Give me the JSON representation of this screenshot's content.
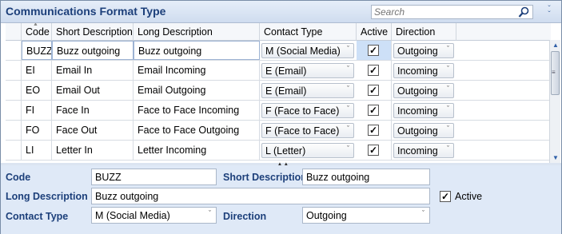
{
  "window": {
    "title": "Communications Format Type"
  },
  "search": {
    "placeholder": "Search"
  },
  "grid": {
    "columns": [
      "Code",
      "Short Description",
      "Long Description",
      "Contact Type",
      "Active",
      "Direction"
    ],
    "rows": [
      {
        "code": "BUZZ",
        "short": "Buzz outgoing",
        "long": "Buzz outgoing",
        "contact": "M (Social Media)",
        "active": true,
        "direction": "Outgoing"
      },
      {
        "code": "EI",
        "short": "Email In",
        "long": "Email Incoming",
        "contact": "E (Email)",
        "active": true,
        "direction": "Incoming"
      },
      {
        "code": "EO",
        "short": "Email Out",
        "long": "Email Outgoing",
        "contact": "E (Email)",
        "active": true,
        "direction": "Outgoing"
      },
      {
        "code": "FI",
        "short": "Face In",
        "long": "Face to Face Incoming",
        "contact": "F (Face to Face)",
        "active": true,
        "direction": "Incoming"
      },
      {
        "code": "FO",
        "short": "Face Out",
        "long": "Face to Face Outgoing",
        "contact": "F (Face to Face)",
        "active": true,
        "direction": "Outgoing"
      },
      {
        "code": "LI",
        "short": "Letter In",
        "long": "Letter Incoming",
        "contact": "L (Letter)",
        "active": true,
        "direction": "Incoming"
      }
    ]
  },
  "detail": {
    "code_label": "Code",
    "code_value": "BUZZ",
    "short_label": "Short Description",
    "short_value": "Buzz outgoing",
    "long_label": "Long Description",
    "long_value": "Buzz outgoing",
    "active_label": "Active",
    "active_checked": true,
    "contact_label": "Contact Type",
    "contact_value": "M (Social Media)",
    "direction_label": "Direction",
    "direction_value": "Outgoing"
  },
  "colors": {
    "accent": "#1c3f7a",
    "header_bg": "#cfdcef",
    "detail_bg": "#dfe9f7",
    "selection": "#cde0f7"
  }
}
